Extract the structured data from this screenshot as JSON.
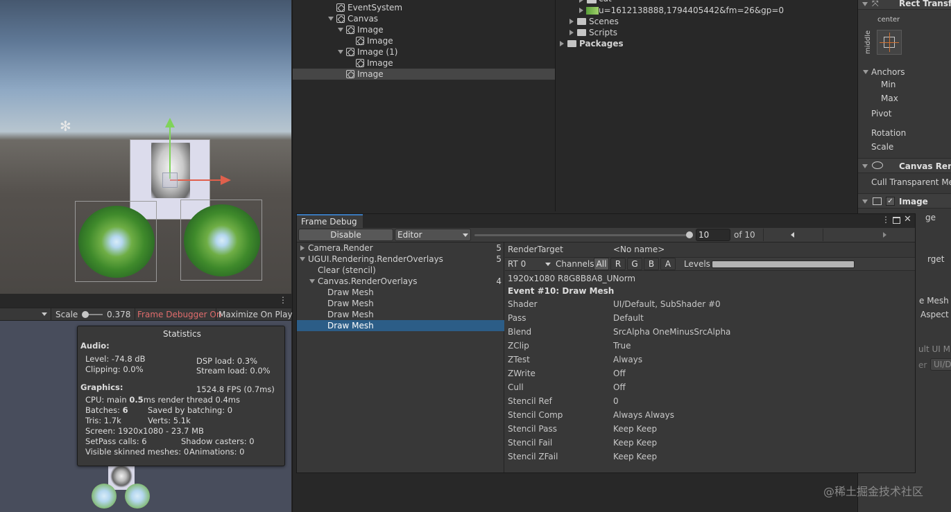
{
  "hierarchy": {
    "items": [
      "EventSystem",
      "Canvas",
      "Image",
      "Image",
      "Image (1)",
      "Image",
      "Image"
    ]
  },
  "project": {
    "items": [
      "cat",
      "u=1612138888,1794405442&fm=26&gp=0",
      "Scenes",
      "Scripts",
      "Packages"
    ]
  },
  "scene_toolbar": {
    "scale_label": "Scale",
    "scale_value": "0.378",
    "frame_debugger_on": "Frame Debugger On",
    "maximize_on_play": "Maximize On Play"
  },
  "statistics": {
    "title": "Statistics",
    "audio_heading": "Audio:",
    "level": "Level: -74.8 dB",
    "dsp_load": "DSP load: 0.3%",
    "clipping": "Clipping: 0.0%",
    "stream_load": "Stream load: 0.0%",
    "graphics_heading": "Graphics:",
    "fps": "1524.8 FPS (0.7ms)",
    "cpu_prefix": "CPU: main ",
    "cpu_main": "0.5",
    "cpu_suffix": "ms  render thread 0.4ms",
    "batches_prefix": "Batches: ",
    "batches": "6",
    "saved_by_batching": "Saved by batching: 0",
    "tris": "Tris: 1.7k",
    "verts": "Verts: 5.1k",
    "screen": "Screen: 1920x1080 - 23.7 MB",
    "setpass": "SetPass calls: 6",
    "shadow_casters": "Shadow casters: 0",
    "visible_skinned": "Visible skinned meshes: 0",
    "animations": "Animations: 0"
  },
  "inspector": {
    "rect_transform": "Rect Transfo",
    "anchor_center": "center",
    "anchor_middle": "middle",
    "anchors": "Anchors",
    "min": "Min",
    "max": "Max",
    "pivot": "Pivot",
    "rotation": "Rotation",
    "scale": "Scale",
    "canvas_renderer": "Canvas Rend",
    "cull_transparent": "Cull Transparent Mes",
    "image": "Image",
    "ge": "ge",
    "rget": "rget",
    "e_mesh": "e Mesh",
    "aspect": "Aspect",
    "ult_ui": "ult UI M",
    "er": "er",
    "ui_de": "UI/De"
  },
  "frame_debug": {
    "tab": "Frame Debug",
    "disable": "Disable",
    "target": "Editor",
    "event_value": "10",
    "of_total": "of 10",
    "tree": [
      {
        "label": "Camera.Render",
        "count": "5"
      },
      {
        "label": "UGUI.Rendering.RenderOverlays",
        "count": "5"
      },
      {
        "label": "Clear (stencil)",
        "count": ""
      },
      {
        "label": "Canvas.RenderOverlays",
        "count": "4"
      },
      {
        "label": "Draw Mesh",
        "count": ""
      },
      {
        "label": "Draw Mesh",
        "count": ""
      },
      {
        "label": "Draw Mesh",
        "count": ""
      },
      {
        "label": "Draw Mesh",
        "count": ""
      }
    ],
    "render_target_label": "RenderTarget",
    "render_target_value": "<No name>",
    "rt": "RT 0",
    "channels": "Channels",
    "channel_buttons": [
      "All",
      "R",
      "G",
      "B",
      "A"
    ],
    "levels": "Levels",
    "format": "1920x1080 R8G8B8A8_UNorm",
    "event_title": "Event #10: Draw Mesh",
    "props": [
      {
        "k": "Shader",
        "v": "UI/Default, SubShader #0"
      },
      {
        "k": "Pass",
        "v": "Default"
      },
      {
        "k": "Blend",
        "v": "SrcAlpha OneMinusSrcAlpha"
      },
      {
        "k": "ZClip",
        "v": "True"
      },
      {
        "k": "ZTest",
        "v": "Always"
      },
      {
        "k": "ZWrite",
        "v": "Off"
      },
      {
        "k": "Cull",
        "v": "Off"
      },
      {
        "k": "Stencil Ref",
        "v": "0"
      },
      {
        "k": "Stencil Comp",
        "v": "Always Always"
      },
      {
        "k": "Stencil Pass",
        "v": "Keep Keep"
      },
      {
        "k": "Stencil Fail",
        "v": "Keep Keep"
      },
      {
        "k": "Stencil ZFail",
        "v": "Keep Keep"
      }
    ]
  },
  "watermark": "@稀土掘金技术社区",
  "colors": {
    "selection": "#2c5d87",
    "tab_accent": "#3a79bb",
    "frame_debugger_on": "#e06c6c"
  }
}
